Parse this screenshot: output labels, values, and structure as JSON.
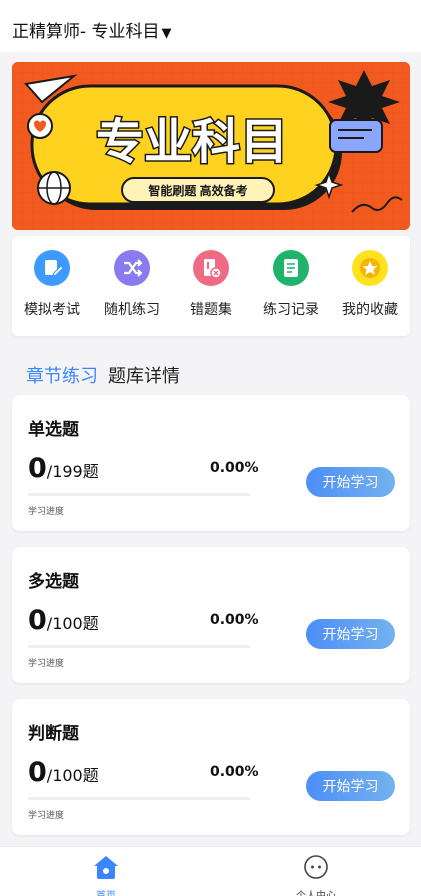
{
  "header": {
    "title": "正精算师- 专业科目",
    "caret": "▼"
  },
  "banner": {
    "title": "专业科目",
    "subtitle": "智能刷题 高效备考"
  },
  "quick_actions": [
    {
      "label": "模拟考试",
      "icon": "edit-icon",
      "color": "#3d9bff"
    },
    {
      "label": "随机练习",
      "icon": "shuffle-icon",
      "color": "#8b7bf0"
    },
    {
      "label": "错题集",
      "icon": "error-book-icon",
      "color": "#f16a83"
    },
    {
      "label": "练习记录",
      "icon": "record-icon",
      "color": "#1fb36b"
    },
    {
      "label": "我的收藏",
      "icon": "star-icon",
      "color": "#ffe21f"
    }
  ],
  "tabs": [
    {
      "label": "章节练习",
      "active": true
    },
    {
      "label": "题库详情",
      "active": false
    }
  ],
  "sections": [
    {
      "title": "单选题",
      "done": "0",
      "total_text": "/199",
      "unit": "题",
      "percent": "0.00%",
      "progress_label": "学习进度",
      "button": "开始学习"
    },
    {
      "title": "多选题",
      "done": "0",
      "total_text": "/100",
      "unit": "题",
      "percent": "0.00%",
      "progress_label": "学习进度",
      "button": "开始学习"
    },
    {
      "title": "判断题",
      "done": "0",
      "total_text": "/100",
      "unit": "题",
      "percent": "0.00%",
      "progress_label": "学习进度",
      "button": "开始学习"
    }
  ],
  "tabbar": [
    {
      "label": "首页",
      "icon": "home-icon",
      "active": true
    },
    {
      "label": "个人中心",
      "icon": "profile-icon",
      "active": false
    }
  ],
  "colors": {
    "accent": "#3a86ff",
    "banner_bg": "#f25a1f",
    "banner_yellow": "#ffd21f"
  }
}
